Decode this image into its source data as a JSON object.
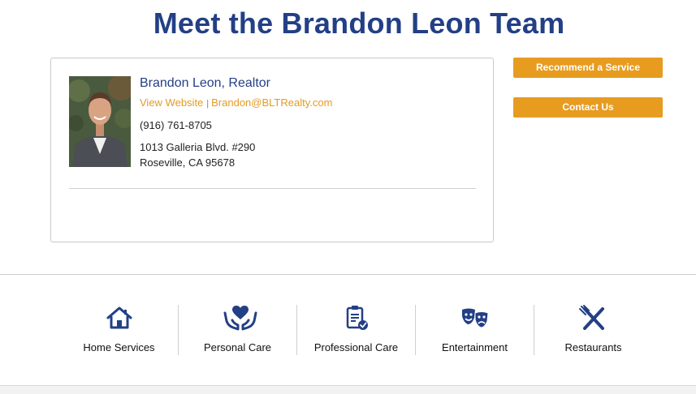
{
  "page": {
    "title": "Meet the Brandon Leon Team"
  },
  "profile": {
    "name": "Brandon Leon, Realtor",
    "website_label": "View Website",
    "separator": "|",
    "email": "Brandon@BLTRealty.com",
    "phone": "(916) 761-8705",
    "address_line1": "1013 Galleria Blvd. #290",
    "address_line2": "Roseville, CA 95678"
  },
  "actions": {
    "recommend_label": "Recommend a Service",
    "contact_label": "Contact Us"
  },
  "categories": [
    {
      "label": "Home Services",
      "icon": "house-icon"
    },
    {
      "label": "Personal Care",
      "icon": "heart-hands-icon"
    },
    {
      "label": "Professional Care",
      "icon": "clipboard-check-icon"
    },
    {
      "label": "Entertainment",
      "icon": "theater-masks-icon"
    },
    {
      "label": "Restaurants",
      "icon": "fork-knife-icon"
    }
  ],
  "colors": {
    "brand_blue": "#233f86",
    "accent_orange": "#e79c20",
    "link_orange": "#e39b22",
    "divider_gray": "#cfcfcf"
  }
}
